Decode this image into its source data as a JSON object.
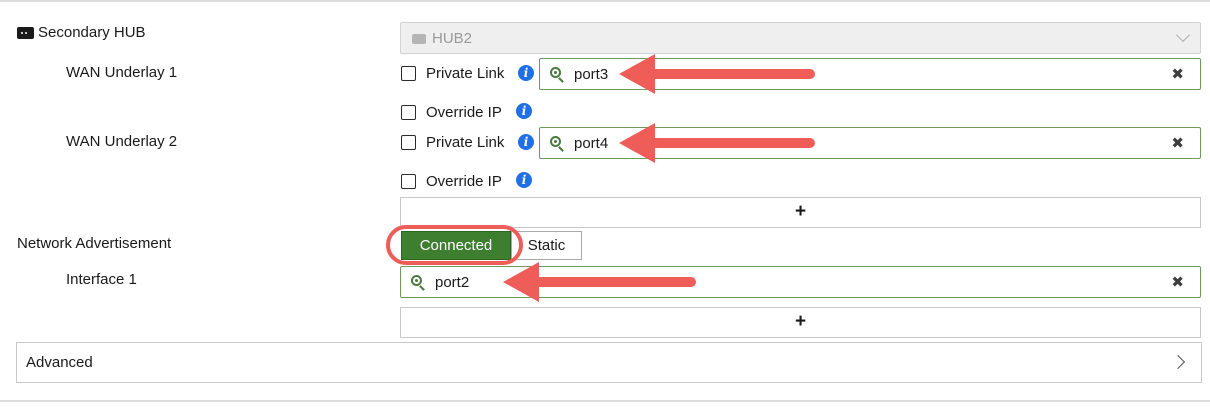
{
  "secondary_hub": {
    "label": "Secondary HUB",
    "value": "HUB2"
  },
  "wan_underlay_1": {
    "label": "WAN Underlay 1",
    "private_link_label": "Private Link",
    "interface_value": "port3",
    "override_ip_label": "Override IP"
  },
  "wan_underlay_2": {
    "label": "WAN Underlay 2",
    "private_link_label": "Private Link",
    "interface_value": "port4",
    "override_ip_label": "Override IP"
  },
  "add_button_symbol": "+",
  "clear_symbol": "✖",
  "network_advertisement": {
    "label": "Network Advertisement",
    "options": [
      "Connected",
      "Static"
    ],
    "selected": "Connected"
  },
  "interface_1": {
    "label": "Interface 1",
    "value": "port2"
  },
  "advanced": {
    "label": "Advanced"
  },
  "colors": {
    "accent_green": "#3d7e2f",
    "annotation_red": "#ee5d58",
    "info_blue": "#1f6fe5"
  }
}
